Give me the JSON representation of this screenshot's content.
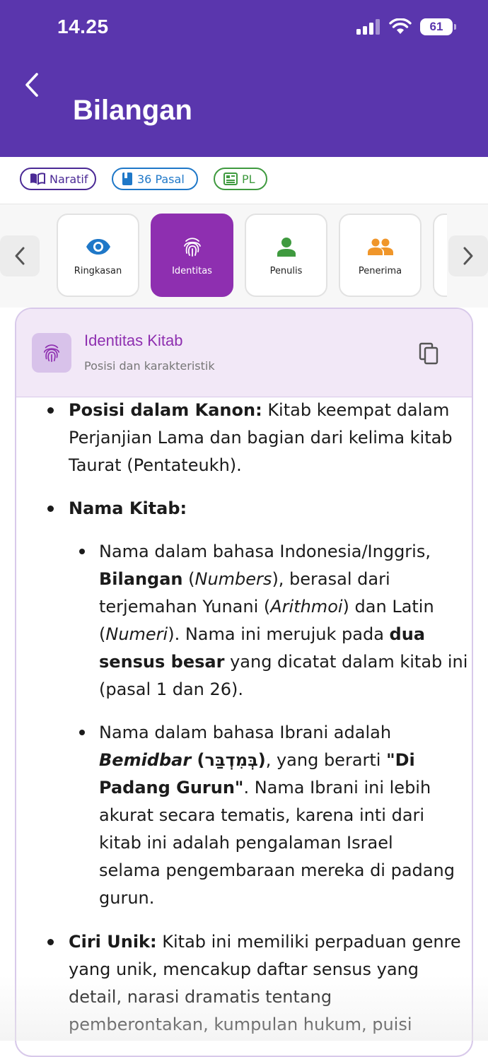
{
  "status": {
    "time": "14.25",
    "battery": "61"
  },
  "header": {
    "title": "Bilangan"
  },
  "chips": [
    {
      "label": "Naratif",
      "color": "#4b2a95",
      "icon": "book-open-icon"
    },
    {
      "label": "36 Pasal",
      "color": "#1f78c8",
      "icon": "book-icon"
    },
    {
      "label": "PL",
      "color": "#3f9a3f",
      "icon": "newspaper-icon"
    }
  ],
  "tabs": [
    {
      "label": "Ringkasan",
      "icon": "eye-icon",
      "color": "#1f78c8"
    },
    {
      "label": "Identitas",
      "icon": "fingerprint-icon",
      "color": "#ffffff",
      "active": true
    },
    {
      "label": "Penulis",
      "icon": "person-icon",
      "color": "#3f9a3f"
    },
    {
      "label": "Penerima",
      "icon": "people-icon",
      "color": "#f0962a"
    }
  ],
  "card": {
    "title": "Identitas Kitab",
    "subtitle": "Posisi dan karakteristik",
    "items": {
      "kanon": {
        "heading": "Posisi dalam Kanon:",
        "l1": "Kitab keempat dalam",
        "l2": "Perjanjian Lama dan bagian dari kelima kitab",
        "l3": "Taurat (Pentateukh)."
      },
      "nama": {
        "heading": "Nama Kitab:",
        "sub1": {
          "l1": "Nama dalam bahasa Indonesia/Inggris,",
          "l2a": "Bilangan",
          "l2b": "(",
          "l2c": "Numbers",
          "l2d": "), berasal dari",
          "l3a": "terjemahan Yunani (",
          "l3b": "Arithmoi",
          "l3c": ") dan Latin",
          "l4a": "(",
          "l4b": "Numeri",
          "l4c": "). Nama ini merujuk pada ",
          "l4d": "dua",
          "l5a": "sensus besar",
          "l5b": " yang dicatat dalam kitab ini",
          "l6": "(pasal 1 dan 26)."
        },
        "sub2": {
          "l1": "Nama dalam bahasa Ibrani adalah",
          "l2a": "Bemidbar",
          "l2b": " (בְּמִדְבַּר)",
          "l2c": ", yang berarti ",
          "l2d": "\"Di",
          "l3a": "Padang Gurun\"",
          "l3b": ". Nama Ibrani ini lebih",
          "l4": "akurat secara tematis, karena inti dari",
          "l5": "kitab ini adalah pengalaman Israel",
          "l6": "selama pengembaraan mereka di padang",
          "l7": "gurun."
        }
      },
      "ciri": {
        "heading": "Ciri Unik:",
        "l1": " Kitab ini memiliki perpaduan genre",
        "l2": "yang unik, mencakup daftar sensus yang",
        "l3": "detail, narasi dramatis tentang",
        "l4": "pemberontakan, kumpulan hukum, puisi"
      }
    }
  }
}
